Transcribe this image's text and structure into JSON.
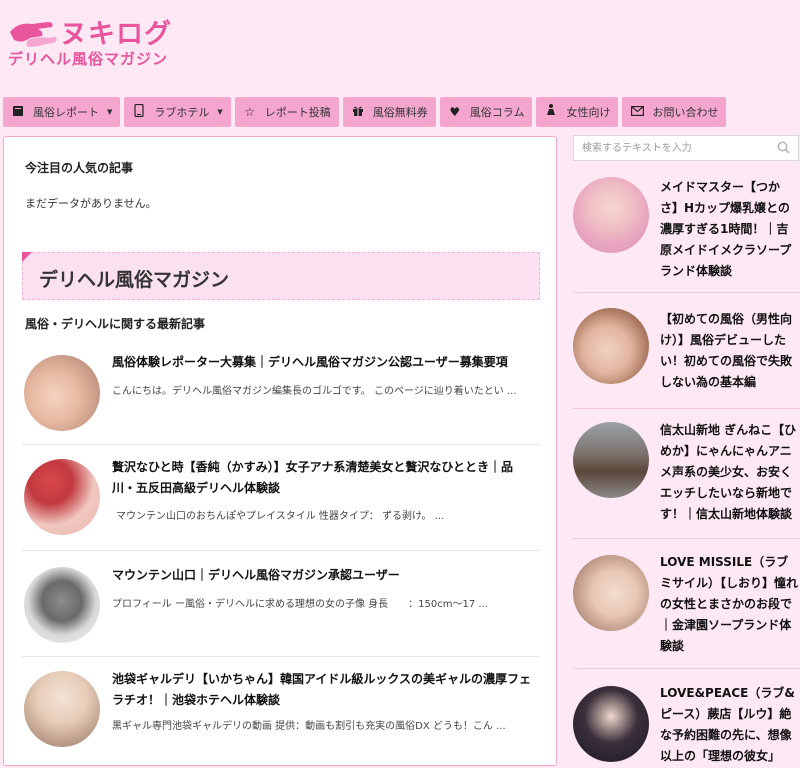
{
  "brand": {
    "main": "ヌキログ",
    "sub": "デリヘル風俗マガジン"
  },
  "nav": [
    {
      "icon": "book-icon",
      "label": "風俗レポート",
      "has_dropdown": true
    },
    {
      "icon": "mobile-icon",
      "label": "ラブホテル",
      "has_dropdown": true
    },
    {
      "icon": "star-icon",
      "label": "レポート投稿",
      "has_dropdown": false
    },
    {
      "icon": "gift-icon",
      "label": "風俗無料券",
      "has_dropdown": false
    },
    {
      "icon": "heart-icon",
      "label": "風俗コラム",
      "has_dropdown": false
    },
    {
      "icon": "person-icon",
      "label": "女性向け",
      "has_dropdown": false
    },
    {
      "icon": "mail-icon",
      "label": "お問い合わせ",
      "has_dropdown": false
    }
  ],
  "main": {
    "popular_title": "今注目の人気の記事",
    "no_data": "まだデータがありません。",
    "banner": "デリヘル風俗マガジン",
    "latest_title": "風俗・デリヘルに関する最新記事",
    "articles": [
      {
        "title": "風俗体験レポーター大募集｜デリヘル風俗マガジン公認ユーザー募集要項",
        "excerpt": "こんにちは。デリヘル風俗マガジン編集長のゴルゴです。 このページに辿り着いたとい ..."
      },
      {
        "title": "贅沢なひと時【香純（かすみ）】女子アナ系清楚美女と贅沢なひととき｜品川・五反田高級デリヘル体験談",
        "excerpt": "マウンテン山口のおちんぽやプレイスタイル 性器タイプ： ずる剥け。 ..."
      },
      {
        "title": "マウンテン山口｜デリヘル風俗マガジン承認ユーザー",
        "excerpt": "プロフィール ー風俗・デリヘルに求める理想の女の子像 身長　　：150cm～17 ..."
      },
      {
        "title": "池袋ギャルデリ【いかちゃん】韓国アイドル級ルックスの美ギャルの濃厚フェラチオ！｜池袋ホテヘル体験談",
        "excerpt": "黒ギャル専門池袋ギャルデリの動画 提供：動画も割引も充実の風俗DX どうも！こん ..."
      }
    ]
  },
  "sidebar": {
    "search_placeholder": "検索するテキストを入力",
    "items": [
      {
        "title": "メイドマスター【つかさ】Hカップ爆乳嬢との濃厚すぎる1時間！｜吉原メイドイメクラソープランド体験談"
      },
      {
        "title": "【初めての風俗（男性向け）】風俗デビューしたい！初めての風俗で失敗しない為の基本編"
      },
      {
        "title": "信太山新地 ぎんねこ【ひめか】にゃんにゃんアニメ声系の美少女、お安くエッチしたいなら新地です！｜信太山新地体験談"
      },
      {
        "title": "LOVE MISSILE（ラブミサイル）【しおり】憧れの女性とまさかのお段で｜金津園ソープランド体験談"
      },
      {
        "title": "LOVE&PEACE（ラブ&ピース）蕨店【ルウ】絶な予約困難の先に、想像以上の「理想の彼女」"
      }
    ]
  },
  "colors": {
    "accent": "#e8559d",
    "nav_bg": "#f5a6cf",
    "page_bg": "#fde8f4"
  }
}
